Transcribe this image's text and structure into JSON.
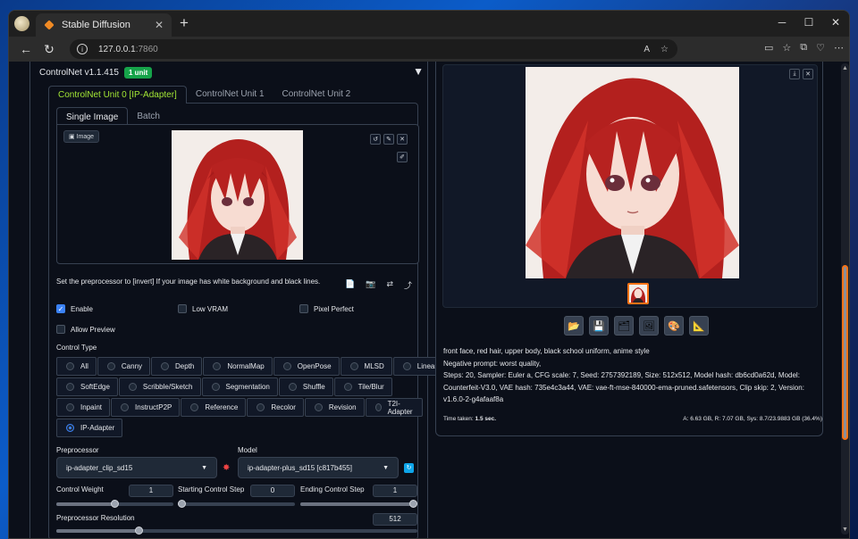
{
  "browser": {
    "tab_title": "Stable Diffusion",
    "tab_close": "✕",
    "new_tab": "+",
    "url_host": "127.0.0.1",
    "url_port": ":7860",
    "win_min": "─",
    "win_max": "☐",
    "win_close": "✕"
  },
  "controlnet": {
    "title": "ControlNet v1.1.415",
    "badge": "1 unit",
    "unit_tabs": [
      "ControlNet Unit 0 [IP-Adapter]",
      "ControlNet Unit 1",
      "ControlNet Unit 2"
    ],
    "image_tabs": [
      "Single Image",
      "Batch"
    ],
    "image_label": "Image",
    "hint": "Set the preprocessor to [invert] If your image has white background and black lines.",
    "enable_label": "Enable",
    "low_vram_label": "Low VRAM",
    "pixel_perfect_label": "Pixel Perfect",
    "allow_preview_label": "Allow Preview",
    "control_type_label": "Control Type",
    "control_types": [
      [
        "All",
        "Canny",
        "Depth",
        "NormalMap",
        "OpenPose",
        "MLSD",
        "Lineart"
      ],
      [
        "SoftEdge",
        "Scribble/Sketch",
        "Segmentation",
        "Shuffle",
        "Tile/Blur"
      ],
      [
        "Inpaint",
        "InstructP2P",
        "Reference",
        "Recolor",
        "Revision",
        "T2I-Adapter"
      ],
      [
        "IP-Adapter"
      ]
    ],
    "selected_control_type": "IP-Adapter",
    "preprocessor_label": "Preprocessor",
    "preprocessor_value": "ip-adapter_clip_sd15",
    "model_label": "Model",
    "model_value": "ip-adapter-plus_sd15 [c817b455]",
    "control_weight_label": "Control Weight",
    "control_weight": "1",
    "control_weight_fraction": 0.5,
    "start_step_label": "Starting Control Step",
    "start_step": "0",
    "start_step_fraction": 0,
    "end_step_label": "Ending Control Step",
    "end_step": "1",
    "end_step_fraction": 1,
    "resolution_label": "Preprocessor Resolution",
    "resolution": "512",
    "resolution_fraction": 0.23
  },
  "output": {
    "prompt": "front face, red hair, upper body, black school uniform, anime style",
    "negative": "Negative prompt: worst quality,",
    "params": "Steps: 20, Sampler: Euler a, CFG scale: 7, Seed: 2757392189, Size: 512x512, Model hash: db6cd0a62d, Model: Counterfeit-V3.0, VAE hash: 735e4c3a44, VAE: vae-ft-mse-840000-ema-pruned.safetensors, Clip skip: 2, Version: v1.6.0-2-g4afaaf8a",
    "time_label": "Time taken:",
    "time_value": "1.5 sec.",
    "memory": "A: 6.63 GB, R: 7.07 GB, Sys: 8.7/23.9883 GB (36.4%)"
  },
  "colors": {
    "accent_green": "#a3e635",
    "badge_green": "#16a34a",
    "selected_blue": "#3b82f6",
    "thumb_border": "#f97316"
  },
  "icons": [
    "folder-icon",
    "save-icon",
    "zip-icon",
    "img2img-icon",
    "inpaint-icon",
    "extras-icon"
  ]
}
